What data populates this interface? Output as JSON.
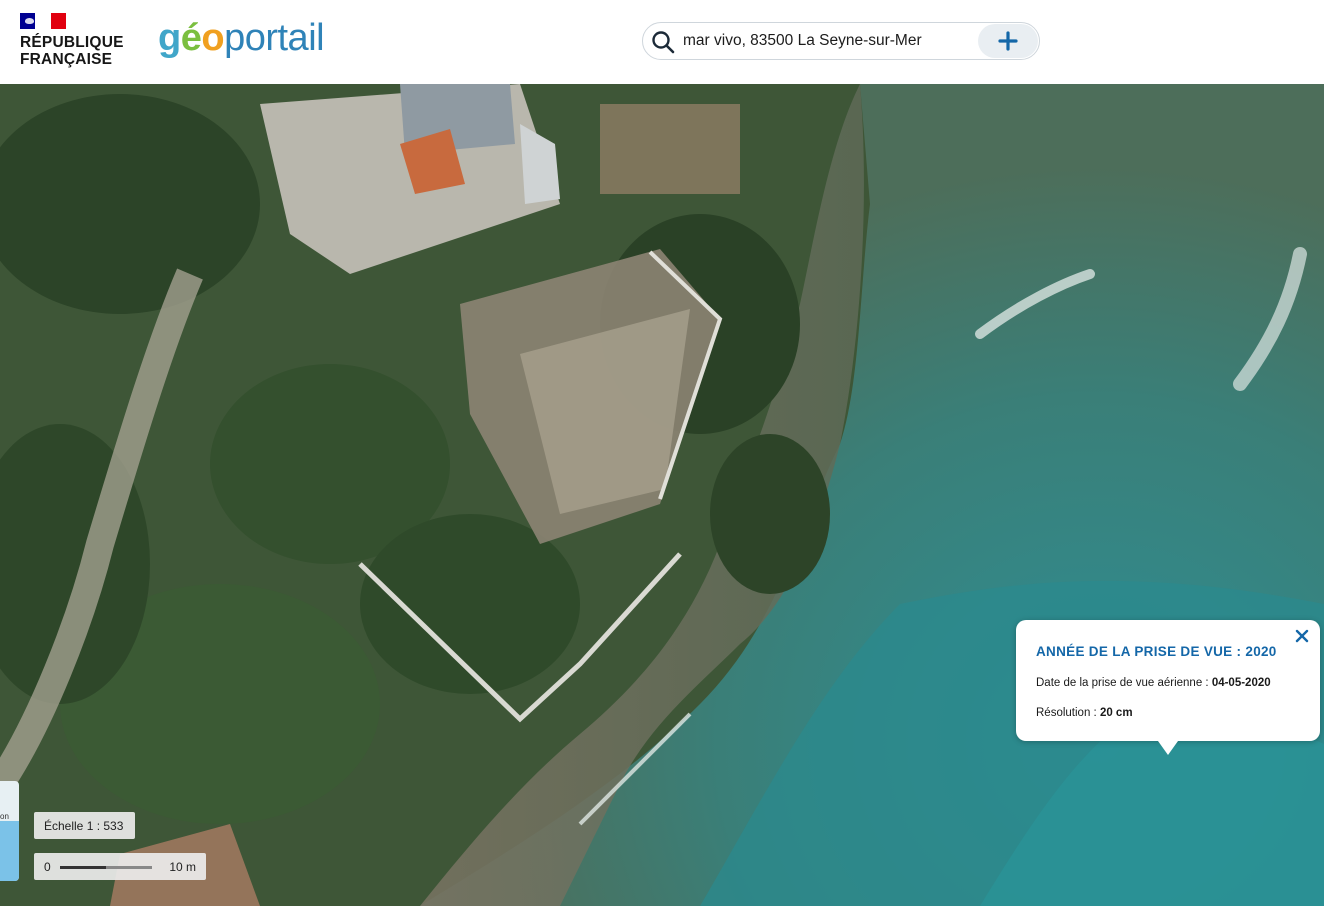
{
  "header": {
    "republique_line1": "RÉPUBLIQUE",
    "republique_line2": "FRANÇAISE",
    "logo": {
      "g": "g",
      "e": "é",
      "o": "o",
      "portail": "portail"
    }
  },
  "search": {
    "value": "mar vivo, 83500 La Seyne-sur-Mer",
    "icon": "search-icon",
    "add_icon": "plus-icon"
  },
  "popup": {
    "title": "ANNÉE DE LA PRISE DE VUE : 2020",
    "date_label": "Date de la prise de vue aérienne : ",
    "date_value": "04-05-2020",
    "resolution_label": "Résolution : ",
    "resolution_value": "20 cm",
    "close_icon": "close-icon"
  },
  "scale": {
    "text": "Échelle 1 : 533",
    "bar_start": "0",
    "bar_end": "10 m"
  },
  "minimap": {
    "label": "on"
  },
  "colors": {
    "header_bg": "#ffffff",
    "popup_title": "#1467a8",
    "sea": "#3f8f90",
    "vegetation": "#2f4a2a",
    "rock": "#6e6a5a"
  }
}
